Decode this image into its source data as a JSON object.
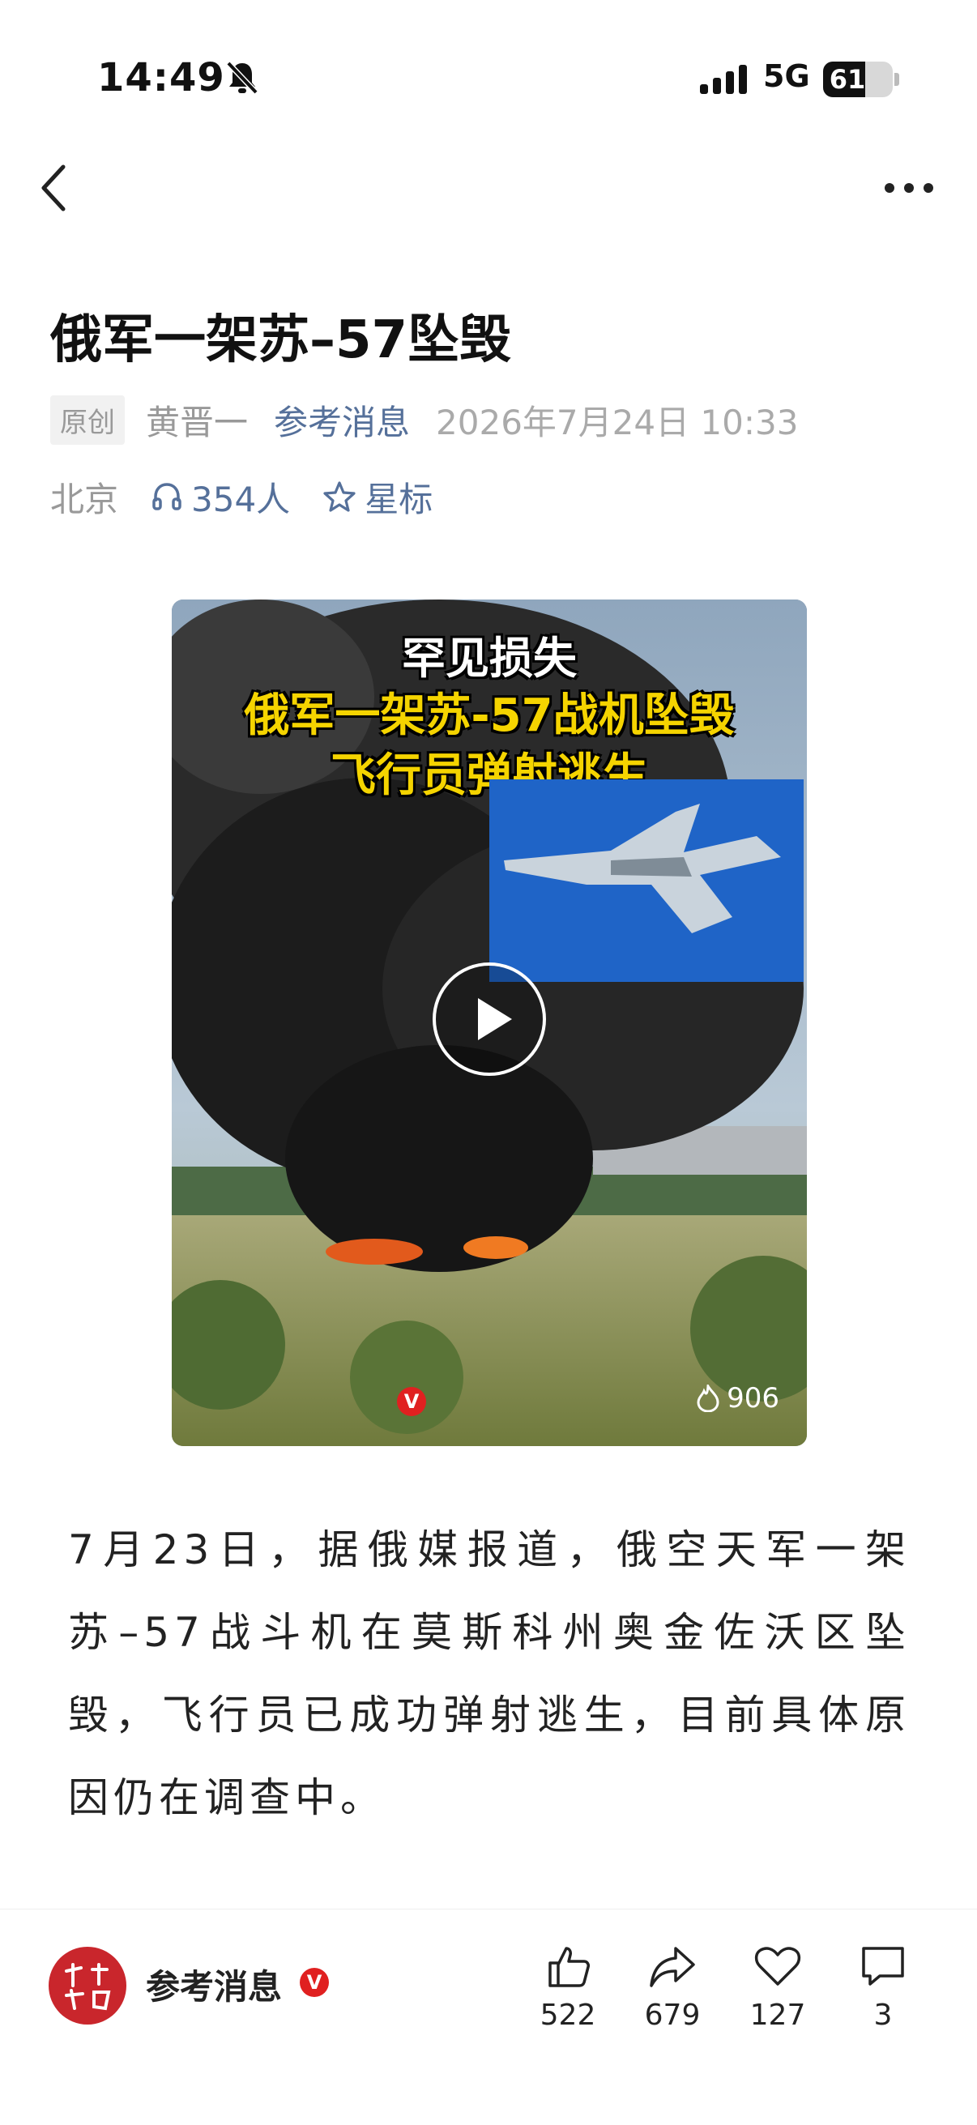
{
  "status_bar": {
    "time": "14:49",
    "network": "5G",
    "battery": "61",
    "battery_level": 0.61,
    "icons": [
      "bell-muted-icon",
      "signal-icon",
      "battery-icon"
    ]
  },
  "nav": {
    "back_icon": "chevron-left-icon",
    "more_icon": "more-dots-icon"
  },
  "article": {
    "title": "俄军一架苏–57坠毁",
    "badge": "原创",
    "author": "黄晋一",
    "source": "参考消息",
    "date": "2026年7月24日 10:33",
    "location": "北京",
    "listen_count": "354人",
    "star_label": "星标",
    "body": "7月23日，据俄媒报道，俄空天军一架苏–57战斗机在莫斯科州奥金佐沃区坠毁，飞行员已成功弹射逃生，目前具体原因仍在调查中。"
  },
  "video": {
    "caption_line1": "罕见损失",
    "caption_line2": "俄军一架苏-57战机坠毁",
    "caption_line3": "飞行员弹射逃生",
    "views": "906",
    "badge": "V",
    "icons": [
      "play-icon",
      "flame-icon",
      "verified-icon"
    ]
  },
  "bottom_bar": {
    "account_name": "参考消息",
    "verified": "V",
    "like_count": "522",
    "share_count": "679",
    "favorite_count": "127",
    "comment_count": "3",
    "icons": [
      "thumbs-up-icon",
      "share-icon",
      "heart-icon",
      "comment-icon"
    ]
  },
  "colors": {
    "accent": "#55709a",
    "muted": "#999999",
    "brand_red": "#c9262c"
  }
}
